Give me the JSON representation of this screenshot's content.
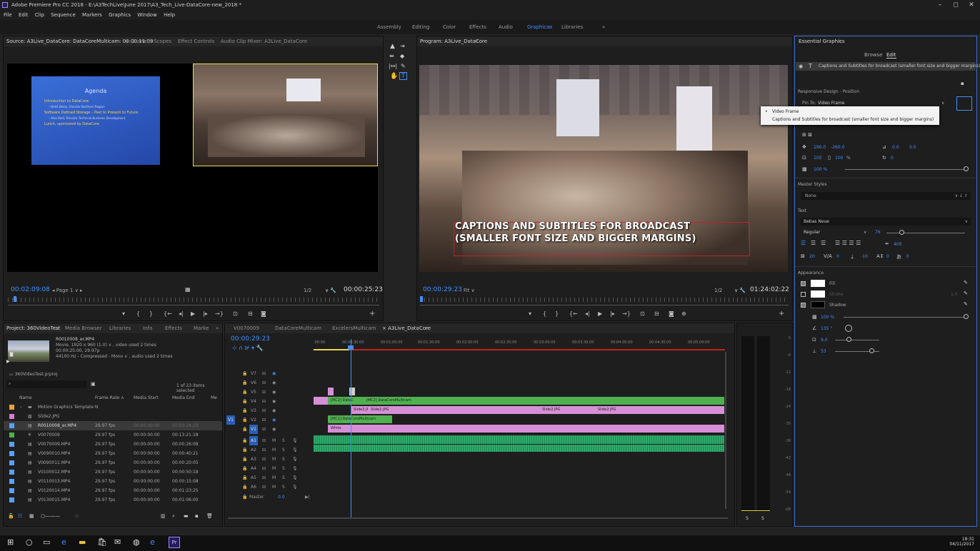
{
  "window": {
    "title": "Adobe Premiere Pro CC 2018 - E:\\A3TechLive\\June 2017\\A3_Tech_Live-DataCore-new_2018 *",
    "controls": [
      "–",
      "◻",
      "✕"
    ]
  },
  "menu": [
    "File",
    "Edit",
    "Clip",
    "Sequence",
    "Markers",
    "Graphics",
    "Window",
    "Help"
  ],
  "workspaces": {
    "items": [
      "Assembly",
      "Editing",
      "Color",
      "Effects",
      "Audio",
      "Graphics",
      "≡",
      "Libraries",
      "»"
    ],
    "active": "Graphics"
  },
  "source": {
    "tabs": [
      "Source: A3Live_DataCore: DataCoreMulticam: 00:00:11:09",
      "≡",
      "Lumetri Scopes",
      "Effect Controls",
      "Audio Clip Mixer: A3Live_DataCore"
    ],
    "timecode": "00:02:09:08",
    "page": "Page 1",
    "scale": "1/2",
    "duration": "00:00:25:23",
    "slide_title": "Agenda",
    "slide_bullets": [
      "Introduction to DataCore",
      "– Brett Denly, Director Northern Region",
      "Software Defined Storage – Past to Present to Future",
      "– Alex Best, Director Technical Business Development",
      "Lunch, sponsored by DataCore"
    ]
  },
  "program": {
    "tab": "Program: A3Live_DataCore",
    "timecode": "00:00:29:23",
    "fit": "Fit",
    "scale": "1/2",
    "duration": "01:24:02:22",
    "caption_line1": "CAPTIONS AND SUBTITLES FOR BROADCAST",
    "caption_line2": "(SMALLER FONT SIZE AND BIGGER MARGINS)"
  },
  "essential_graphics": {
    "title": "Essential Graphics",
    "tabs": [
      "Browse",
      "Edit"
    ],
    "active_tab": "Edit",
    "layer": "Captions and Subtitles for broadcast (smaller font size and bigger margins)",
    "responsive_label": "Responsive Design - Position",
    "pin_to_label": "Pin To:",
    "pin_to_value": "Video Frame",
    "dropdown_options": [
      "Video Frame",
      "Captions and Subtitles for broadcast (smaller font size and bigger margins)"
    ],
    "position": [
      "190.0",
      "-260.0"
    ],
    "anchor": [
      "0.0",
      "0.0"
    ],
    "scale": "100",
    "scale_unit": "%",
    "rotation": "0",
    "opacity": "100 %",
    "master_styles_label": "Master Styles",
    "master_style": "None",
    "text_label": "Text",
    "font": "Bebas Neue",
    "font_style": "Regular",
    "font_size": "76",
    "tracking_value": "400",
    "leading": "20",
    "kerning": "0",
    "baseline": "-10",
    "tsume": "0",
    "tsume2": "0",
    "appearance_label": "Appearance",
    "fill": "Fill",
    "stroke": "Stroke",
    "stroke_width": "1.0",
    "shadow": "Shadow",
    "shadow_opacity": "100 %",
    "shadow_angle": "135 °",
    "shadow_distance": "9.0",
    "shadow_blur": "53"
  },
  "project": {
    "tabs": [
      "Project: 360VideoTest",
      "≡",
      "Media Browser",
      "Libraries",
      "Info",
      "Effects",
      "Marke",
      "»"
    ],
    "clip_name": "R0010008_er.MP4",
    "clip_info": [
      "Movie, 1920 x 960 (1.0) ∨ , video used 2 times",
      "00:00:25:00, 29.97p",
      "44100 Hz - Compressed - Mono ∨ , audio used 2 times"
    ],
    "project_file": "360VideoTest.prproj",
    "selection_count": "1 of 23 items selected",
    "columns": [
      "Name",
      "Frame Rate ∧",
      "Media Start",
      "Media End",
      "Me"
    ],
    "rows": [
      {
        "name": "Motion Graphics Template N",
        "fps": "",
        "start": "",
        "end": "",
        "color": "#e8a13a"
      },
      {
        "name": "Slide2.JPG",
        "fps": "",
        "start": "",
        "end": "",
        "color": "#d67ad6"
      },
      {
        "name": "R0010008_er.MP4",
        "fps": "29.97 fps",
        "start": "00:00:00:00",
        "end": "00:00:24:29",
        "color": "#5aa0ff"
      },
      {
        "name": "V0070009",
        "fps": "29.97 fps",
        "start": "00:00:00:00",
        "end": "00:13:21:18",
        "color": "#4fb04f"
      },
      {
        "name": "V0070009.MP4",
        "fps": "29.97 fps",
        "start": "00:00:00:00",
        "end": "00:00:26:08",
        "color": "#5aa0ff"
      },
      {
        "name": "V0090010.MP4",
        "fps": "29.97 fps",
        "start": "00:00:00:00",
        "end": "00:00:40:21",
        "color": "#5aa0ff"
      },
      {
        "name": "V0090011.MP4",
        "fps": "29.97 fps",
        "start": "00:00:00:00",
        "end": "00:00:20:05",
        "color": "#5aa0ff"
      },
      {
        "name": "V0100012.MP4",
        "fps": "29.97 fps",
        "start": "00:00:00:00",
        "end": "00:00:50:18",
        "color": "#5aa0ff"
      },
      {
        "name": "V0110013.MP4",
        "fps": "29.97 fps",
        "start": "00:00:00:00",
        "end": "00:00:15:08",
        "color": "#5aa0ff"
      },
      {
        "name": "V0120014.MP4",
        "fps": "29.97 fps",
        "start": "00:00:00:00",
        "end": "00:01:23:25",
        "color": "#5aa0ff"
      },
      {
        "name": "V0130015.MP4",
        "fps": "29.97 fps",
        "start": "00:00:00:00",
        "end": "00:01:06:00",
        "color": "#5aa0ff"
      }
    ]
  },
  "timeline": {
    "tabs": [
      "V0070009",
      "DataCoreMulticam",
      "ExcelersMulticam",
      "×  A3Live_DataCore",
      "≡"
    ],
    "timecode": "00:00:29:23",
    "ruler": [
      ":00:00",
      "00:00:30:00",
      "00:01:00:00",
      "00:01:30:00",
      "00:02:00:00",
      "00:02:30:00",
      "00:03:00:00",
      "00:03:30:00",
      "00:04:00:00",
      "00:04:30:00",
      "00:05:00:00"
    ],
    "video_tracks": [
      "V7",
      "V6",
      "V5",
      "V4",
      "V3",
      "V2",
      "V1"
    ],
    "audio_tracks": [
      "A1",
      "A2",
      "A3",
      "A4",
      "A5",
      "A6"
    ],
    "master_label": "Master",
    "master_value": "0.0",
    "clip_mc1": "[MC2] DataC",
    "clip_mc2": "[MC2] DataCoreMulticam",
    "clip_mc_v2": "[MC1] DataCoreMulticam",
    "clip_slide": "Slide2.JPG",
    "clip_white": "White"
  },
  "meter_ticks": [
    "0",
    "-6",
    "-12",
    "-18",
    "-24",
    "-30",
    "-36",
    "-42",
    "-48",
    "-54",
    "-dB"
  ],
  "taskbar": {
    "time": "18:31",
    "date": "04/11/2017"
  }
}
